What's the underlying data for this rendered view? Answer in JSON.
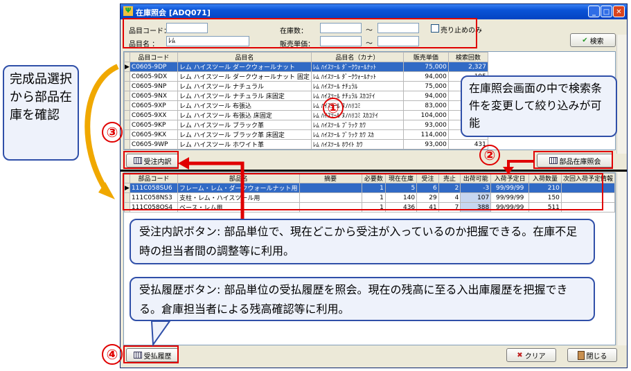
{
  "window": {
    "title": "在庫照会 [ADQ071]"
  },
  "search": {
    "item_code_label": "品目コード：",
    "item_code_value": "",
    "item_name_label": "品目名 ：",
    "item_name_value": "ﾚﾑ",
    "stock_label": "在庫数：",
    "price_label": "販売単価：",
    "tilde": "～",
    "discontinued_label": "売り止めのみ",
    "search_button": "検索"
  },
  "product_table": {
    "headers": [
      "品目コード",
      "品目名",
      "品目名（カナ）",
      "販売単価",
      "検索回数"
    ],
    "rows": [
      [
        "C0605-9DP",
        "レム ハイスツール ダークウォールナット",
        "ﾚﾑ ﾊｲｽﾂｰﾙ ﾀﾞｰｸｳｫｰﾙﾅｯﾄ",
        "75,000",
        "2,327"
      ],
      [
        "C0605-9DX",
        "レム ハイスツール ダークウォールナット 固定",
        "ﾚﾑ ﾊｲｽﾂｰﾙ ﾀﾞｰｸｳｫｰﾙﾅｯﾄ",
        "94,000",
        "195"
      ],
      [
        "C0605-9NP",
        "レム ハイスツール ナチュラル",
        "ﾚﾑ ﾊｲｽﾂｰﾙ ﾅﾁｭﾗﾙ",
        "75,000",
        "811"
      ],
      [
        "C0605-9NX",
        "レム ハイスツール ナチュラル 床固定",
        "ﾚﾑ ﾊｲｽﾂｰﾙ ﾅﾁｭﾗﾙ ｽｶｺﾃｲ",
        "94,000",
        "110"
      ],
      [
        "C0605-9XP",
        "レム ハイスツール 布張込",
        "ﾚﾑ ﾊｲｽﾂｰﾙ ﾇﾉﾊﾘｺﾐ",
        "83,000",
        "356"
      ],
      [
        "C0605-9XX",
        "レム ハイスツール 布張込 床固定",
        "ﾚﾑ ﾊｲｽﾂｰﾙ ﾇﾉﾊﾘｺﾐ ｽｶｺﾃｲ",
        "104,000",
        "117"
      ],
      [
        "C0605-9KP",
        "レム ハイスツール ブラック革",
        "ﾚﾑ ﾊｲｽﾂｰﾙ ﾌﾞﾗｯｸ ｶﾜ",
        "93,000",
        "513"
      ],
      [
        "C0605-9KX",
        "レム ハイスツール ブラック革 床固定",
        "ﾚﾑ ﾊｲｽﾂｰﾙ ﾌﾞﾗｯｸ ｶﾜ ｽｶ",
        "114,000",
        "100"
      ],
      [
        "C0605-9WP",
        "レム ハイスツール ホワイト革",
        "ﾚﾑ ﾊｲｽﾂｰﾙ ﾎﾜｲﾄ ｶﾜ",
        "93,000",
        "431"
      ]
    ]
  },
  "buttons": {
    "order_detail": "受注内訳",
    "parts_inventory": "部品在庫照会",
    "receipt_history": "受払履歴",
    "clear": "クリア",
    "close": "閉じる"
  },
  "parts_table": {
    "headers": [
      "部品コード",
      "部品名",
      "摘要",
      "必要数",
      "現在在庫",
      "受注",
      "売止",
      "出荷可能",
      "入荷予定日",
      "入荷数量",
      "次回入荷予定情報"
    ],
    "rows": [
      [
        "111C058SU6",
        "フレーム・レム・ダークウォールナット用",
        "",
        "1",
        "5",
        "6",
        "2",
        "-3",
        "99/99/99",
        "210",
        ""
      ],
      [
        "111C058NS3",
        "支柱・レム・ハイスツール用",
        "",
        "1",
        "140",
        "29",
        "4",
        "107",
        "99/99/99",
        "150",
        ""
      ],
      [
        "111C058OS4",
        "ベース・レム用",
        "",
        "1",
        "436",
        "41",
        "7",
        "388",
        "99/99/99",
        "511",
        ""
      ]
    ]
  },
  "annotations": {
    "left_note": "完成品選択から部品在庫を確認",
    "right_note": "在庫照会画面の中で検索条件を変更して絞り込みが可能",
    "order_note": "受注内訳ボタン: 部品単位で、現在どこから受注が入っているのか把握できる。在庫不足時の担当者間の調整等に利用。",
    "history_note": "受払履歴ボタン: 部品単位の受払履歴を照会。現在の残高に至る入出庫履歴を把握できる。倉庫担当者による残高確認等に利用。",
    "n1": "①",
    "n2": "②",
    "n3": "③",
    "n4": "④"
  },
  "colors": {
    "accent_red": "#e00000",
    "callout_border": "#2f4fa8",
    "selection": "#316ac5"
  }
}
